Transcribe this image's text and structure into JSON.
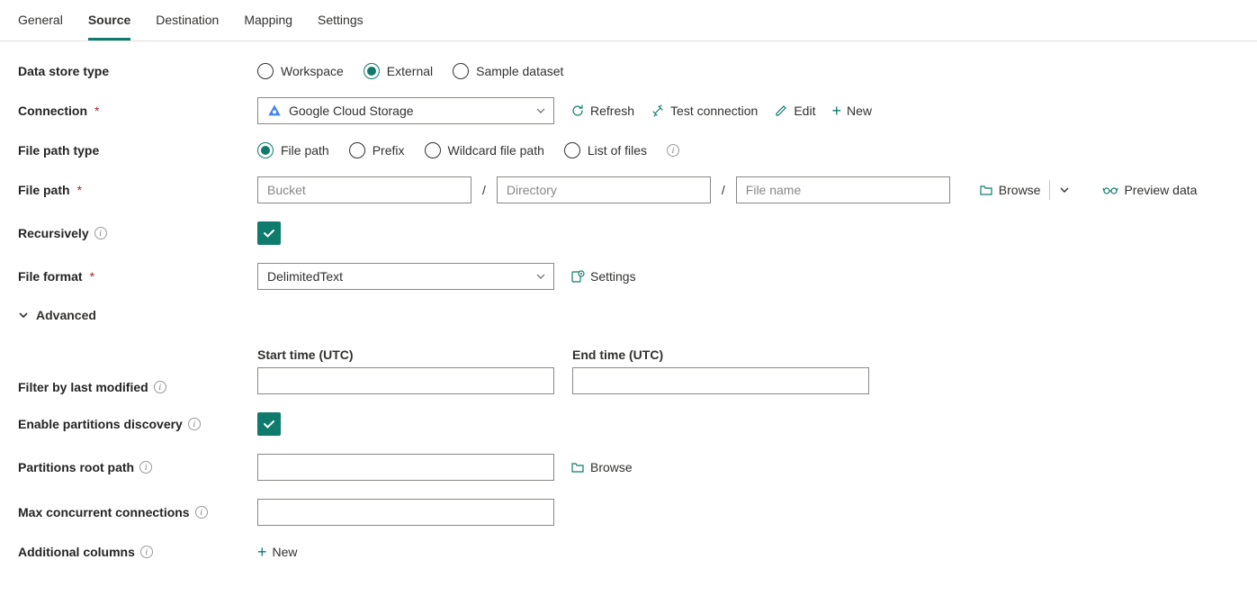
{
  "tabs": {
    "general": "General",
    "source": "Source",
    "destination": "Destination",
    "mapping": "Mapping",
    "settings": "Settings",
    "active": "source"
  },
  "labels": {
    "data_store_type": "Data store type",
    "connection": "Connection",
    "file_path_type": "File path type",
    "file_path": "File path",
    "recursively": "Recursively",
    "file_format": "File format",
    "advanced": "Advanced",
    "filter_last_modified": "Filter by last modified",
    "enable_partitions": "Enable partitions discovery",
    "partitions_root": "Partitions root path",
    "max_concurrent": "Max concurrent connections",
    "additional_columns": "Additional columns"
  },
  "data_store_type": {
    "workspace": "Workspace",
    "external": "External",
    "sample": "Sample dataset",
    "selected": "external"
  },
  "connection": {
    "value": "Google Cloud Storage",
    "actions": {
      "refresh": "Refresh",
      "test": "Test connection",
      "edit": "Edit",
      "new": "New"
    }
  },
  "file_path_type": {
    "file_path": "File path",
    "prefix": "Prefix",
    "wildcard": "Wildcard file path",
    "list": "List of files",
    "selected": "file_path"
  },
  "file_path": {
    "bucket_ph": "Bucket",
    "dir_ph": "Directory",
    "file_ph": "File name",
    "bucket": "",
    "dir": "",
    "file": "",
    "browse": "Browse",
    "preview": "Preview data"
  },
  "recursively": {
    "checked": true
  },
  "file_format": {
    "value": "DelimitedText",
    "settings": "Settings"
  },
  "time": {
    "start_label": "Start time (UTC)",
    "end_label": "End time (UTC)",
    "start": "",
    "end": ""
  },
  "enable_partitions": {
    "checked": true
  },
  "partitions_root": {
    "value": "",
    "browse": "Browse"
  },
  "max_concurrent": {
    "value": ""
  },
  "additional_columns": {
    "new": "New"
  }
}
